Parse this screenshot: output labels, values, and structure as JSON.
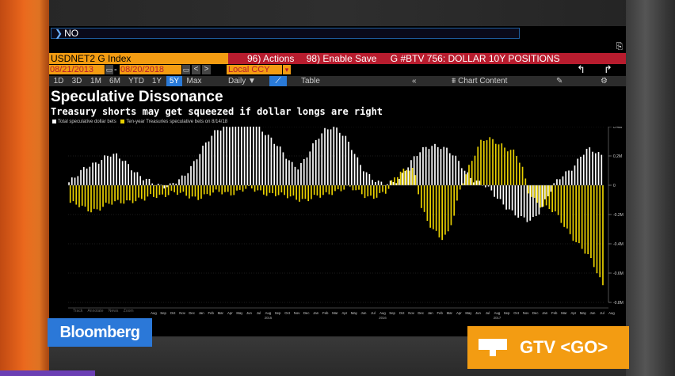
{
  "command_line": {
    "text": "NO"
  },
  "ticker": "USDNET2 G Index",
  "actions": {
    "actions_label": "96) Actions",
    "enable_save_label": "98) Enable Save",
    "chart_ref": "G #BTV 756: DOLLAR 10Y POSITIONS"
  },
  "dates": {
    "start": "08/21/2013",
    "end": "08/20/2018",
    "currency": "Local CCY",
    "dash": "-"
  },
  "periods": [
    "1D",
    "3D",
    "1M",
    "6M",
    "YTD",
    "1Y",
    "5Y",
    "Max"
  ],
  "active_period": "5Y",
  "toolbar": {
    "frequency": "Daily ▼",
    "table_label": "Table",
    "collapse": "«",
    "chart_content": "Chart Content"
  },
  "chart": {
    "title": "Speculative Dissonance",
    "subtitle": "Treasury shorts may get squeezed if dollar longs are right",
    "legend": [
      {
        "label": "Total speculative dollar bets",
        "color": "#ffffff"
      },
      {
        "label": "Ten-year Treasuries speculative bets on 8/14/18",
        "color": "#e8d000"
      }
    ],
    "plot_tools": [
      "Track",
      "Annotate",
      "News",
      "Zoom"
    ]
  },
  "chart_data": {
    "type": "bar",
    "y_tick_labels": [
      "0.4M",
      "0.2M",
      "0",
      "-0.2M",
      "-0.4M",
      "-0.6M",
      "-0.8M"
    ],
    "ylim": [
      -0.8,
      0.4
    ],
    "x_tick_labels": [
      "Aug",
      "Sep",
      "Oct",
      "Nov",
      "Dec",
      "Jan",
      "Feb",
      "Mar",
      "Apr",
      "May",
      "Jun",
      "Jul",
      "Aug",
      "Sep",
      "Oct",
      "Nov",
      "Dec",
      "Jan",
      "Feb",
      "Mar",
      "Apr",
      "May",
      "Jun",
      "Jul",
      "Aug",
      "Sep",
      "Oct",
      "Nov",
      "Dec",
      "Jan",
      "Feb",
      "Mar",
      "Apr",
      "May",
      "Jun",
      "Jul",
      "Aug",
      "Sep",
      "Oct",
      "Nov",
      "Dec",
      "Jan",
      "Feb",
      "Mar",
      "Apr",
      "May",
      "Jun",
      "Jul",
      "Aug"
    ],
    "year_labels": [
      "2015",
      "2016",
      "2017"
    ],
    "series": [
      {
        "name": "Total speculative dollar bets",
        "color": "#ffffff",
        "values": [
          0.02,
          0.05,
          0.1,
          0.14,
          0.16,
          0.18,
          0.2,
          0.2,
          0.18,
          0.14,
          0.08,
          0.04,
          0.02,
          0.01,
          0.0,
          0.0,
          0.02,
          0.05,
          0.12,
          0.2,
          0.27,
          0.32,
          0.37,
          0.4,
          0.42,
          0.43,
          0.44,
          0.43,
          0.41,
          0.37,
          0.32,
          0.26,
          0.2,
          0.15,
          0.13,
          0.18,
          0.25,
          0.32,
          0.38,
          0.41,
          0.38,
          0.32,
          0.24,
          0.16,
          0.1,
          0.05,
          0.01,
          0.0,
          0.02,
          0.05,
          0.12,
          0.17,
          0.22,
          0.26,
          0.28,
          0.27,
          0.24,
          0.2,
          0.15,
          0.09,
          0.04,
          0.01,
          -0.02,
          -0.06,
          -0.1,
          -0.15,
          -0.2,
          -0.23,
          -0.24,
          -0.22,
          -0.16,
          -0.08,
          0.0,
          0.06,
          0.1,
          0.14,
          0.2,
          0.24,
          0.23,
          0.21
        ]
      },
      {
        "name": "Ten-year Treasuries speculative bets on 8/14/18",
        "color": "#e8d000",
        "values": [
          -0.12,
          -0.14,
          -0.16,
          -0.17,
          -0.16,
          -0.14,
          -0.13,
          -0.12,
          -0.11,
          -0.1,
          -0.1,
          -0.1,
          -0.08,
          -0.07,
          -0.06,
          -0.05,
          -0.06,
          -0.07,
          -0.08,
          -0.08,
          -0.07,
          -0.06,
          -0.05,
          -0.05,
          -0.05,
          -0.04,
          -0.03,
          -0.03,
          -0.04,
          -0.05,
          -0.06,
          -0.07,
          -0.08,
          -0.08,
          -0.09,
          -0.1,
          -0.09,
          -0.08,
          -0.06,
          -0.04,
          -0.03,
          -0.02,
          -0.03,
          -0.05,
          -0.07,
          -0.08,
          -0.07,
          -0.05,
          0.05,
          0.1,
          0.12,
          0.1,
          -0.15,
          -0.25,
          -0.3,
          -0.36,
          -0.34,
          -0.2,
          0.0,
          0.12,
          0.22,
          0.3,
          0.31,
          0.3,
          0.28,
          0.25,
          0.22,
          0.12,
          -0.05,
          -0.1,
          -0.14,
          -0.16,
          -0.2,
          -0.26,
          -0.32,
          -0.38,
          -0.44,
          -0.5,
          -0.58,
          -0.68
        ]
      }
    ],
    "grid": true
  }
}
